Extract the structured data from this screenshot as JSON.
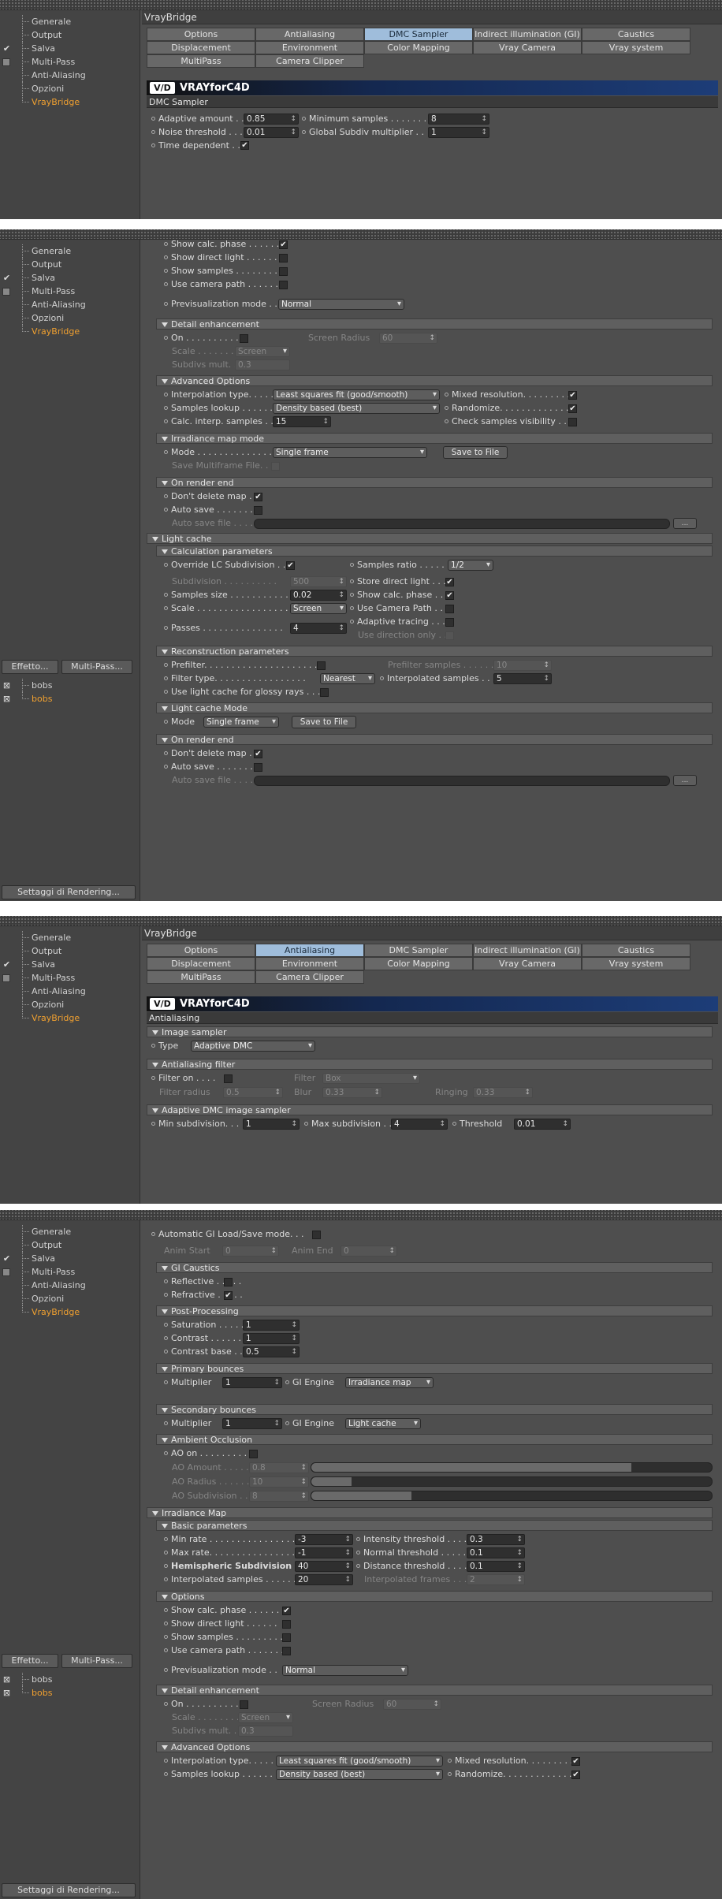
{
  "sidebar": {
    "items": [
      "Generale",
      "Output",
      "Salva",
      "Multi-Pass",
      "Anti-Aliasing",
      "Opzioni",
      "VrayBridge"
    ],
    "effects_button": "Effetto...",
    "multipass_button": "Multi-Pass...",
    "objects": [
      "bobs",
      "bobs"
    ],
    "render_settings_button": "Settaggi di Rendering..."
  },
  "tabs": [
    "Options",
    "Antialiasing",
    "DMC Sampler",
    "Indirect illumination (GI)",
    "Caustics",
    "Displacement",
    "Environment",
    "Color Mapping",
    "Vray Camera",
    "Vray system",
    "MultiPass",
    "Camera Clipper"
  ],
  "window_title": "VrayBridge",
  "logo_text": "VRAYforC4D",
  "panel1": {
    "section": "DMC Sampler",
    "adaptive_amount_label": "Adaptive amount . . . . .",
    "adaptive_amount": "0.85",
    "min_samples_label": "Minimum samples . . . . . . . .",
    "min_samples": "8",
    "noise_threshold_label": "Noise threshold . . . . . .",
    "noise_threshold": "0.01",
    "global_subdiv_label": "Global Subdiv multiplier . .",
    "global_subdiv": "1",
    "time_dependent_label": "Time dependent . . ."
  },
  "panel2": {
    "show_calc_phase": "Show calc. phase . . . . . .",
    "show_direct_light": "Show direct light . . . . . .",
    "show_samples": "Show samples . . . . . . . . .",
    "use_camera_path": "Use camera path . . . . . . .",
    "previs_mode_label": "Previsualization mode . .",
    "previs_mode": "Normal",
    "detail_head": "Detail enhancement",
    "on_label": "On . . . . . . . . . . .",
    "screen_radius_label": "Screen Radius",
    "screen_radius": "60",
    "scale_label": "Scale . . . . . . . .",
    "scale": "Screen",
    "subdivs_mult_label": "Subdivs mult. . . .",
    "subdivs_mult": "0.3",
    "advanced_head": "Advanced Options",
    "interp_type_label": "Interpolation type. . . . .",
    "interp_type": "Least squares fit (good/smooth)",
    "mixed_res_label": "Mixed resolution. . . . . . . . .",
    "samples_lookup_label": "Samples lookup . . . . . .",
    "samples_lookup": "Density based (best)",
    "randomize_label": "Randomize. . . . . . . . . . . . .",
    "calc_interp_label": "Calc. interp. samples . . .",
    "calc_interp": "15",
    "check_vis_label": "Check samples visibility . . .",
    "irr_mode_head": "Irradiance map mode",
    "mode_label": "Mode . . . . . . . . . . . . . . . . .",
    "mode": "Single frame",
    "save_to_file": "Save to File",
    "save_multiframe_label": "Save Multiframe File. . .",
    "render_end_head": "On render end",
    "dont_delete_label": "Don't delete map . . .",
    "auto_save_label": "Auto save . . . . . . . .",
    "auto_save_file_label": "Auto save file . . . . .",
    "ellipsis": "...",
    "light_cache_head": "Light cache",
    "calc_params_head": "Calculation parameters",
    "override_lc_label": "Override LC Subdivision . .",
    "samples_ratio_label": "Samples ratio . . . . .",
    "samples_ratio": "1/2",
    "subdivision_label": "Subdivision . . . . . . . . . .",
    "subdivision": "500",
    "store_direct_label": "Store direct light . . . .",
    "samples_size_label": "Samples size . . . . . . . . . . .",
    "samples_size": "0.02",
    "show_calc_lc_label": "Show calc. phase . . . .",
    "lc_scale_label": "Scale . . . . . . . . . . . . . . . . . .",
    "lc_scale": "Screen",
    "use_cam_path_lc_label": "Use Camera Path . . . .",
    "adaptive_tracing_label": "Adaptive tracing . . . .",
    "passes_label": "Passes . . . . . . . . . . . . . . .",
    "passes": "4",
    "use_dir_only_label": "Use direction only . . .",
    "recon_head": "Reconstruction parameters",
    "prefilter_label": "Prefilter. . . . . . . . . . . . . . . . . . . . . .",
    "prefilter_samples_label": "Prefilter samples . . . . . .",
    "prefilter_samples": "10",
    "filter_type_label": "Filter type. . . . . . . . . . . . . . . . .",
    "filter_type": "Nearest",
    "interp_samples_label": "Interpolated samples . .",
    "interp_samples": "5",
    "use_lc_glossy_label": "Use light cache for glossy rays . . .",
    "lc_mode_head": "Light cache Mode",
    "lc_mode_label": "Mode",
    "lc_mode": "Single frame",
    "lc_render_end_head": "On render end"
  },
  "panel3": {
    "section": "Antialiasing",
    "image_sampler_head": "Image sampler",
    "type_label": "Type",
    "type": "Adaptive DMC",
    "aa_filter_head": "Antialiasing filter",
    "filter_on_label": "Filter on . . . .",
    "filter_label": "Filter",
    "filter": "Box",
    "filter_radius_label": "Filter radius",
    "filter_radius": "0.5",
    "blur_label": "Blur",
    "blur": "0.33",
    "ringing_label": "Ringing",
    "ringing": "0.33",
    "adaptive_head": "Adaptive DMC image sampler",
    "min_subdiv_label": "Min subdivision. . .",
    "min_subdiv": "1",
    "max_subdiv_label": "Max subdivision . .",
    "max_subdiv": "4",
    "threshold_label": "Threshold",
    "threshold": "0.01"
  },
  "panel4": {
    "auto_gi_label": "Automatic GI Load/Save mode. . .",
    "anim_start_label": "Anim Start",
    "anim_start": "0",
    "anim_end_label": "Anim End",
    "anim_end": "0",
    "gi_caustics_head": "GI Caustics",
    "reflective_label": "Reflective . . . . .",
    "refractive_label": "Refractive . . . . .",
    "post_head": "Post-Processing",
    "saturation_label": "Saturation . . . . . .",
    "saturation": "1",
    "contrast_label": "Contrast . . . . . . .",
    "contrast": "1",
    "contrast_base_label": "Contrast base . . .",
    "contrast_base": "0.5",
    "primary_head": "Primary bounces",
    "multiplier_label": "Multiplier",
    "multiplier_primary": "1",
    "gi_engine_label": "GI Engine",
    "primary_engine": "Irradiance map",
    "secondary_head": "Secondary bounces",
    "multiplier_secondary": "1",
    "secondary_engine": "Light cache",
    "ao_head": "Ambient Occlusion",
    "ao_on_label": "AO on . . . . . . . . . . .",
    "ao_amount_label": "AO Amount . . . . . .",
    "ao_amount": "0.8",
    "ao_amount_fill": 0.8,
    "ao_radius_label": "AO Radius . . . . . . .",
    "ao_radius": "10",
    "ao_radius_fill": 0.1,
    "ao_subdiv_label": "AO Subdivision . . .",
    "ao_subdiv": "8",
    "ao_subdiv_fill": 0.25,
    "irr_head": "Irradiance Map",
    "basic_head": "Basic parameters",
    "min_rate_label": "Min rate . . . . . . . . . . . . . . . .",
    "min_rate": "-3",
    "intensity_thr_label": "Intensity threshold . . . .",
    "intensity_thr": "0.3",
    "max_rate_label": "Max rate. . . . . . . . . . . . . . . .",
    "max_rate": "-1",
    "normal_thr_label": "Normal threshold . . . . . .",
    "normal_thr": "0.1",
    "hemi_label": "Hemispheric Subdivision",
    "hemi": "40",
    "distance_thr_label": "Distance threshold . . . .",
    "distance_thr": "0.1",
    "interp_samples_label": "Interpolated samples . . . . . .",
    "interp_samples": "20",
    "interp_frames_label": "Interpolated frames . . .",
    "interp_frames": "2",
    "options_head": "Options",
    "adv_mixed_label": "Mixed resolution. . . . . . . . .",
    "adv_randomize_label": "Randomize. . . . . . . . . . . . . .",
    "interp_type_label": "Interpolation type. . . . .",
    "interp_type": "Least squares fit (good/smooth)",
    "samples_lookup_label": "Samples lookup . . . . . .",
    "samples_lookup": "Density based (best)"
  }
}
